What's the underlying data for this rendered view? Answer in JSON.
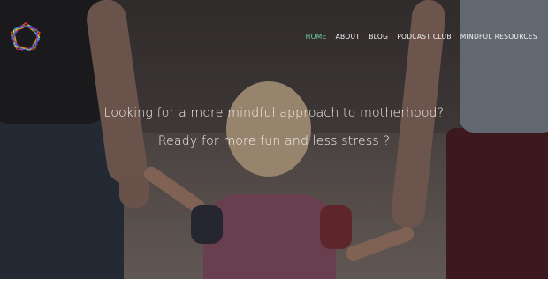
{
  "nav": {
    "items": [
      {
        "label": "HOME",
        "active": true
      },
      {
        "label": "ABOUT",
        "active": false
      },
      {
        "label": "BLOG",
        "active": false
      },
      {
        "label": "PODCAST CLUB",
        "active": false
      },
      {
        "label": "MINDFUL RESOURCES",
        "active": false
      }
    ]
  },
  "hero": {
    "line1": "Looking for a more mindful approach to motherhood?",
    "line2": "Ready for more fun and less stress ?"
  },
  "colors": {
    "nav_active": "#6fd0ac",
    "nav_text": "#f2f2f2",
    "headline": "#f4f1ee"
  },
  "icons": {
    "logo": "rainbow-pentagon-logo-icon"
  }
}
